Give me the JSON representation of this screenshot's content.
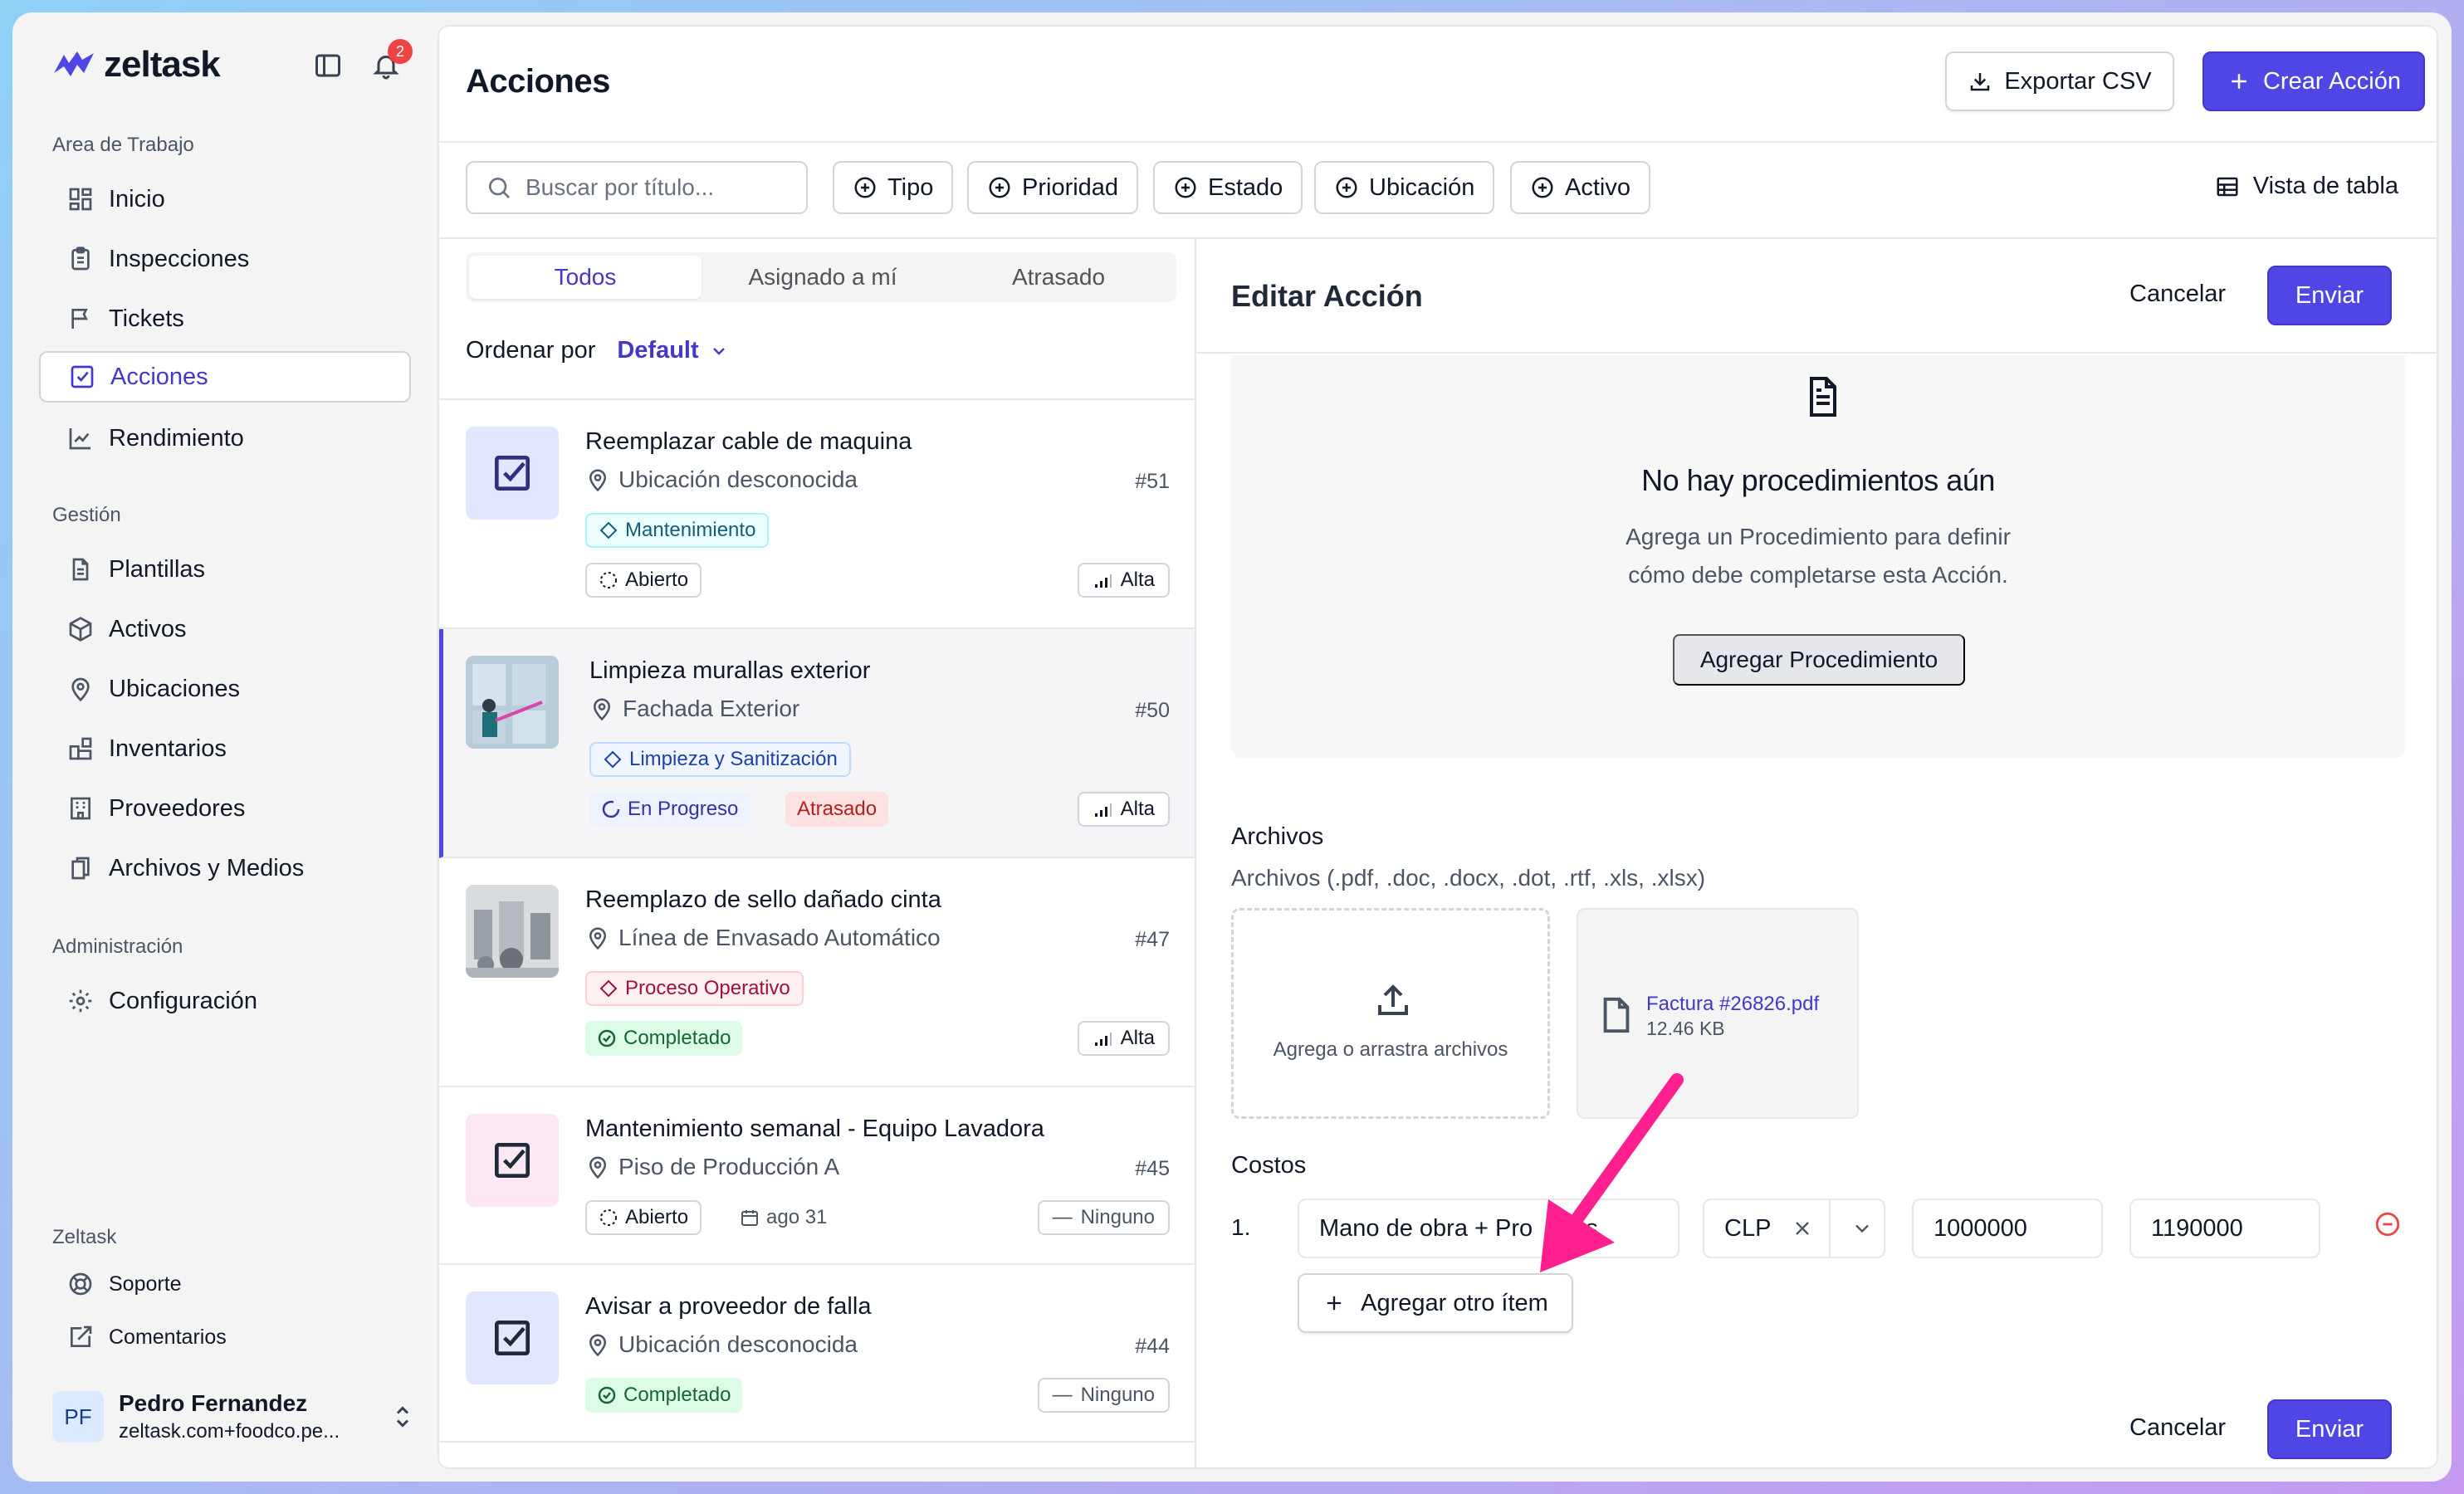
{
  "app": {
    "logo_text": "zeltask",
    "notification_count": "2"
  },
  "sidebar": {
    "workspace_label": "Area de Trabajo",
    "workspace_items": [
      "Inicio",
      "Inspecciones",
      "Tickets",
      "Acciones",
      "Rendimiento"
    ],
    "management_label": "Gestión",
    "management_items": [
      "Plantillas",
      "Activos",
      "Ubicaciones",
      "Inventarios",
      "Proveedores",
      "Archivos y Medios"
    ],
    "admin_label": "Administración",
    "admin_items": [
      "Configuración"
    ],
    "zeltask_label": "Zeltask",
    "zeltask_items": [
      "Soporte",
      "Comentarios"
    ],
    "active_item": "Acciones",
    "user": {
      "initials": "PF",
      "name": "Pedro Fernandez",
      "email": "zeltask.com+foodco.pe..."
    }
  },
  "header": {
    "title": "Acciones",
    "export_label": "Exportar CSV",
    "create_label": "Crear Acción"
  },
  "filters": {
    "search_placeholder": "Buscar por título...",
    "chips": [
      "Tipo",
      "Prioridad",
      "Estado",
      "Ubicación",
      "Activo"
    ],
    "view_label": "Vista de tabla"
  },
  "list": {
    "tabs": [
      "Todos",
      "Asignado a mí",
      "Atrasado"
    ],
    "active_tab": "Todos",
    "sort_label": "Ordenar por",
    "sort_value": "Default",
    "cards": [
      {
        "title": "Reemplazar cable de maquina",
        "location": "Ubicación desconocida",
        "number": "#51",
        "category": "Mantenimiento",
        "status": "Abierto",
        "priority": "Alta"
      },
      {
        "title": "Limpieza murallas exterior",
        "location": "Fachada Exterior",
        "number": "#50",
        "category": "Limpieza y Sanitización",
        "status": "En Progreso",
        "overdue": "Atrasado",
        "priority": "Alta"
      },
      {
        "title": "Reemplazo de sello dañado cinta",
        "location": "Línea de Envasado Automático",
        "number": "#47",
        "category": "Proceso Operativo",
        "status": "Completado",
        "priority": "Alta"
      },
      {
        "title": "Mantenimiento semanal - Equipo Lavadora",
        "location": "Piso de Producción A",
        "number": "#45",
        "status": "Abierto",
        "due": "ago 31",
        "priority": "Ninguno"
      },
      {
        "title": "Avisar a proveedor de falla",
        "location": "Ubicación desconocida",
        "number": "#44",
        "status": "Completado",
        "priority": "Ninguno"
      }
    ]
  },
  "editor": {
    "title": "Editar Acción",
    "cancel_label": "Cancelar",
    "submit_label": "Enviar",
    "empty": {
      "title": "No hay procedimientos aún",
      "desc_line1": "Agrega un Procedimiento para definir",
      "desc_line2": "cómo debe completarse esta Acción.",
      "button": "Agregar Procedimiento"
    },
    "files": {
      "label": "Archivos",
      "hint": "Archivos (.pdf, .doc, .docx, .dot, .rtf, .xls, .xlsx)",
      "drop_text": "Agrega o arrastra archivos",
      "file_name": "Factura #26826.pdf",
      "file_size": "12.46 KB"
    },
    "costs": {
      "label": "Costos",
      "index": "1.",
      "item_name": "Mano de obra + Pro",
      "item_name_tail": "os",
      "currency": "CLP",
      "amount": "1000000",
      "total": "1190000",
      "add_label": "Agregar otro ítem"
    }
  },
  "colors": {
    "accent": "#4f46e5",
    "annotation_arrow": "#ff1f8e"
  }
}
